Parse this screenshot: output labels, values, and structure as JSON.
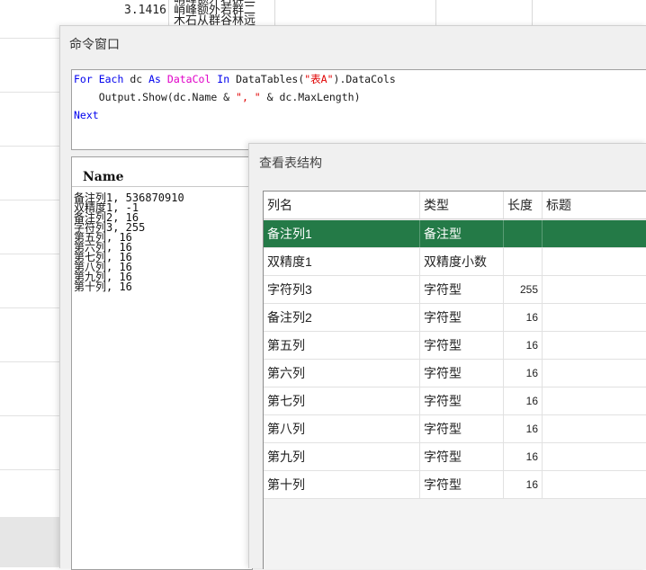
{
  "background_sheet": {
    "number": "3.1416",
    "text": "峭峰额外若群二 峭峰额外若群二 木石从群谷林远"
  },
  "command_window": {
    "title": "命令窗口",
    "code": {
      "line1": {
        "kw_for_each": "For Each",
        "var": " dc ",
        "kw_as": "As",
        "type": "DataCol",
        "kw_in": "In",
        "expr_start": " DataTables(",
        "table_name": "\"表A\"",
        "expr_end": ").DataCols"
      },
      "line2": {
        "start": "    Output.Show(dc.Name & ",
        "sep": "\", \"",
        "end": " & dc.MaxLength)"
      },
      "line3": "Next"
    },
    "output_header": "Name",
    "output_lines": [
      "备注列1, 536870910",
      "双精度1, -1",
      "备注列2, 16",
      "字符列3, 255",
      "第五列, 16",
      "第六列, 16",
      "第七列, 16",
      "第八列, 16",
      "第九列, 16",
      "第十列, 16"
    ]
  },
  "structure_dialog": {
    "title": "查看表结构",
    "columns": {
      "name": "列名",
      "type": "类型",
      "length": "长度",
      "caption": "标题"
    },
    "rows": [
      {
        "name": "备注列1",
        "type": "备注型",
        "length": "",
        "caption": ""
      },
      {
        "name": "双精度1",
        "type": "双精度小数",
        "length": "",
        "caption": ""
      },
      {
        "name": "字符列3",
        "type": "字符型",
        "length": "255",
        "caption": ""
      },
      {
        "name": "备注列2",
        "type": "字符型",
        "length": "16",
        "caption": ""
      },
      {
        "name": "第五列",
        "type": "字符型",
        "length": "16",
        "caption": ""
      },
      {
        "name": "第六列",
        "type": "字符型",
        "length": "16",
        "caption": ""
      },
      {
        "name": "第七列",
        "type": "字符型",
        "length": "16",
        "caption": ""
      },
      {
        "name": "第八列",
        "type": "字符型",
        "length": "16",
        "caption": ""
      },
      {
        "name": "第九列",
        "type": "字符型",
        "length": "16",
        "caption": ""
      },
      {
        "name": "第十列",
        "type": "字符型",
        "length": "16",
        "caption": ""
      }
    ],
    "selected_row_index": 0,
    "selected_color": "#247a47"
  }
}
